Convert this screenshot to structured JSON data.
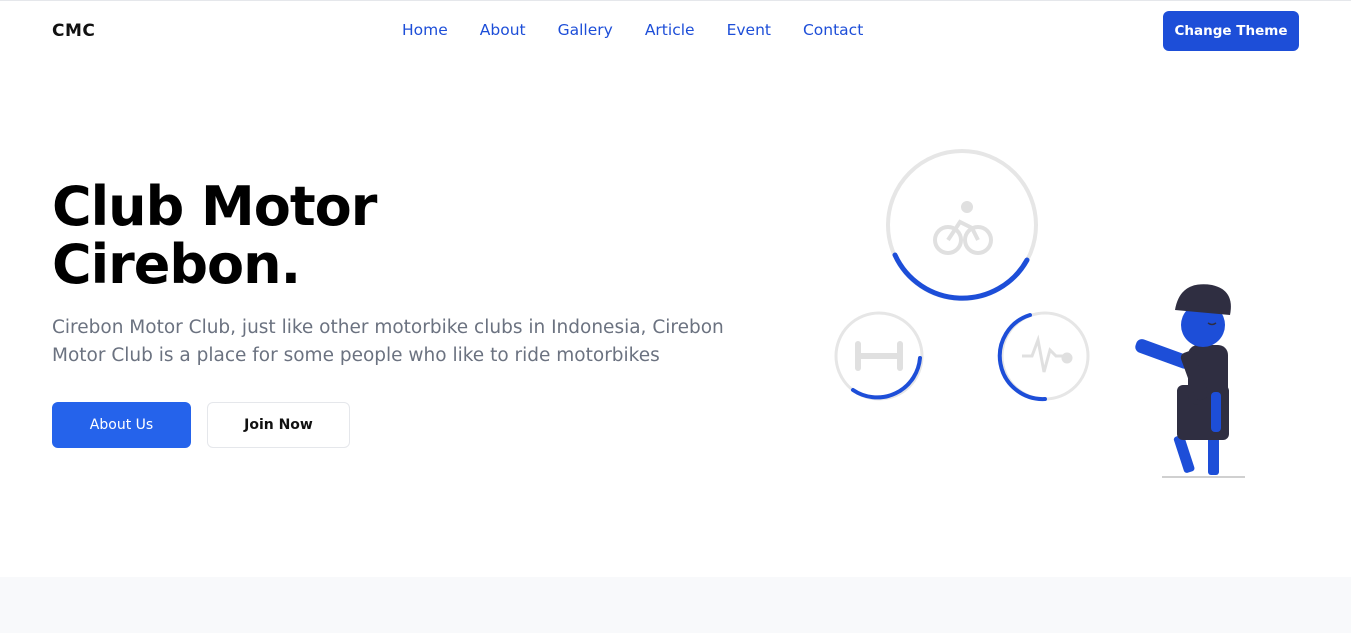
{
  "header": {
    "logo": "CMC",
    "nav": [
      "Home",
      "About",
      "Gallery",
      "Article",
      "Event",
      "Contact"
    ],
    "theme_button": "Change Theme"
  },
  "hero": {
    "title_line1": "Club Motor",
    "title_line2": "Cirebon.",
    "description": "Cirebon Motor Club, just like other motorbike clubs in Indonesia, Cirebon Motor Club is a place for some people who like to ride motorbikes",
    "primary_button": "About Us",
    "secondary_button": "Join Now"
  },
  "illustration": {
    "icons": [
      "bicycle-icon",
      "dumbbell-icon",
      "heartbeat-icon"
    ],
    "progress": {
      "bicycle": 0.3,
      "dumbbell": 0.5,
      "heartbeat": 0.5
    },
    "colors": {
      "accent": "#1d4ed8",
      "ring": "#e6e6e6",
      "figure": "#2f2e41"
    }
  },
  "colors": {
    "brand": "#1d4ed8",
    "primary_button": "#2563eb",
    "text_muted": "#6b7280"
  }
}
